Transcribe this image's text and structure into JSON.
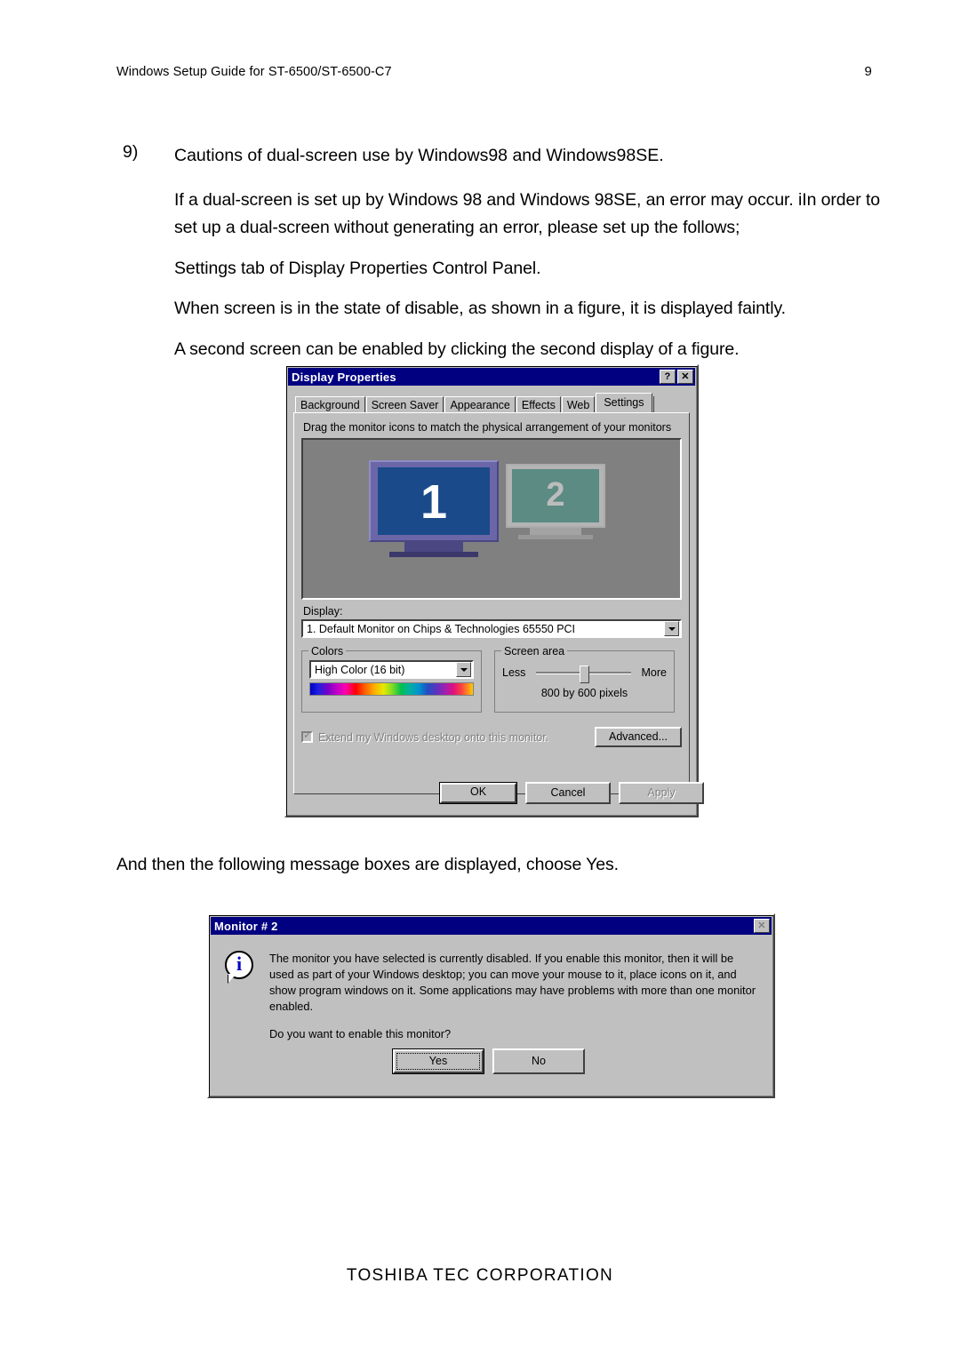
{
  "header": {
    "title": "Windows Setup Guide for ST-6500/ST-6500-C7",
    "page_number": "9"
  },
  "body": {
    "item_marker": "9)",
    "item_title": "Cautions of dual-screen use by Windows98 and Windows98SE.",
    "paragraph_1": "If a dual-screen is set up by Windows 98 and Windows 98SE, an error may occur.  iIn order to set up a dual-screen without generating an error, please set up the follows;",
    "paragraph_2": "Settings tab of Display Properties Control Panel.",
    "paragraph_3": "When screen is in the state of disable, as shown in a figure, it is displayed faintly.",
    "paragraph_4": "A second screen can be enabled by clicking the second display of a figure.",
    "paragraph_after_figure": "And then the following message boxes are displayed, choose Yes."
  },
  "display_properties": {
    "title": "Display Properties",
    "help_button": "?",
    "close_button": "✕",
    "tabs": [
      {
        "label": "Background",
        "active": false
      },
      {
        "label": "Screen Saver",
        "active": false
      },
      {
        "label": "Appearance",
        "active": false
      },
      {
        "label": "Effects",
        "active": false
      },
      {
        "label": "Web",
        "active": false
      },
      {
        "label": "Settings",
        "active": true
      }
    ],
    "hint": "Drag the monitor icons to match the physical arrangement of your monitors",
    "monitors": [
      {
        "number": "1",
        "enabled": true,
        "screen_color": "#1b4a8a"
      },
      {
        "number": "2",
        "enabled": false,
        "screen_color": "#469285"
      }
    ],
    "display_label": "Display:",
    "display_value": "1. Default Monitor on Chips & Technologies 65550 PCI",
    "colors_group": {
      "legend": "Colors",
      "value": "High Color (16 bit)"
    },
    "screen_area_group": {
      "legend": "Screen area",
      "less_label": "Less",
      "more_label": "More",
      "resolution": "800 by 600 pixels"
    },
    "extend_checkbox": {
      "label": "Extend my Windows desktop onto this monitor.",
      "checked": true,
      "disabled": true
    },
    "advanced_button": "Advanced...",
    "buttons": {
      "ok": "OK",
      "cancel": "Cancel",
      "apply": "Apply"
    }
  },
  "monitor_message_box": {
    "title": "Monitor # 2",
    "close_button": "✕",
    "icon": "info-icon",
    "message": "The monitor you have selected is currently disabled. If you enable this monitor, then it will be used as part of your Windows desktop; you can move your mouse to it, place icons on it, and show program windows on it.  Some applications may have problems with more than one monitor enabled.",
    "question": "Do you want to enable this monitor?",
    "yes_button": "Yes",
    "no_button": "No"
  },
  "footer": {
    "company": "TOSHIBA TEC CORPORATION"
  },
  "colors": {
    "titlebar": "#000080",
    "dialog_face": "#c0c0c0",
    "monitor1": "#1b4a8a",
    "monitor2": "#469285"
  }
}
